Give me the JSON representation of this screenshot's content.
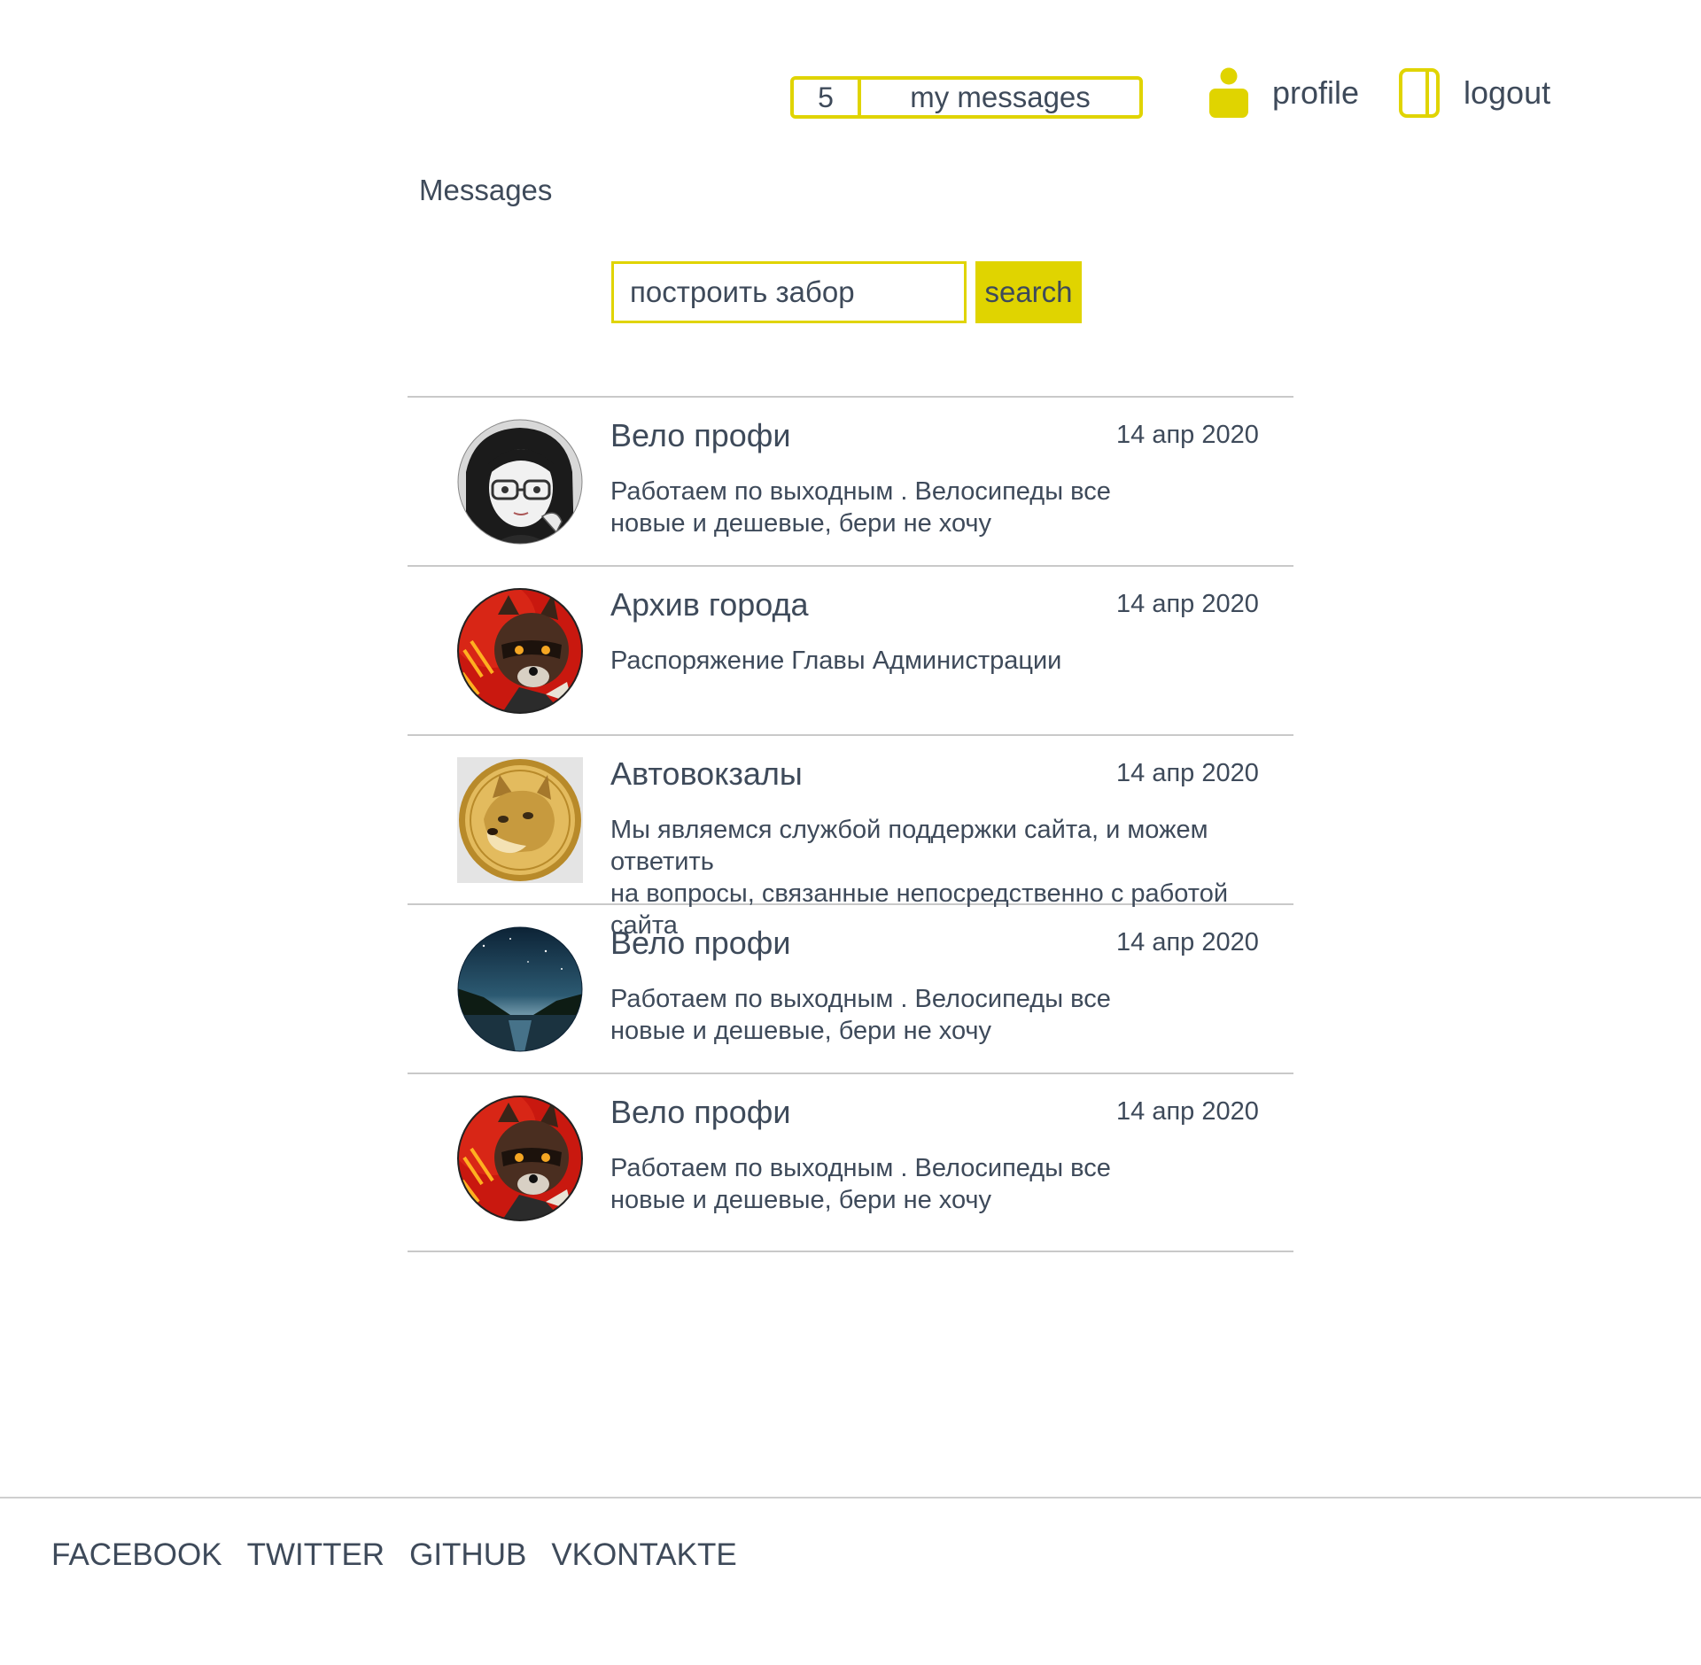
{
  "header": {
    "messages_count": "5",
    "messages_label": "my messages",
    "profile_label": "profile",
    "logout_label": "logout"
  },
  "page": {
    "title": "Messages"
  },
  "search": {
    "value": "построить забор",
    "button_label": "search"
  },
  "messages": [
    {
      "sender": "Вело профи",
      "date": "14 апр 2020",
      "preview": "Работаем по выходным . Велосипеды все\nновые и дешевые, бери не хочу",
      "avatar": "anime-girl-glasses-avatar"
    },
    {
      "sender": "Архив города",
      "date": "14 апр 2020",
      "preview": "Распоряжение Главы Администрации",
      "avatar": "raccoon-avatar"
    },
    {
      "sender": "Автовокзалы",
      "date": "14 апр 2020",
      "preview": "Мы являемся службой поддержки сайта, и можем ответить\nна вопросы, связанные непосредственно с работой сайта",
      "avatar": "doge-coin-avatar"
    },
    {
      "sender": "Вело профи",
      "date": "14 апр 2020",
      "preview": "Работаем по выходным . Велосипеды все\nновые и дешевые, бери не хочу",
      "avatar": "night-lake-avatar"
    },
    {
      "sender": "Вело профи",
      "date": "14 апр 2020",
      "preview": "Работаем по выходным . Велосипеды все\nновые и дешевые, бери не хочу",
      "avatar": "raccoon-avatar"
    }
  ],
  "footer": {
    "links": [
      "FACEBOOK",
      "TWITTER",
      "GITHUB",
      "VKONTAKTE"
    ]
  },
  "colors": {
    "accent": "#e0d400",
    "text": "#3e4a5a",
    "divider": "#c9c9c9"
  }
}
